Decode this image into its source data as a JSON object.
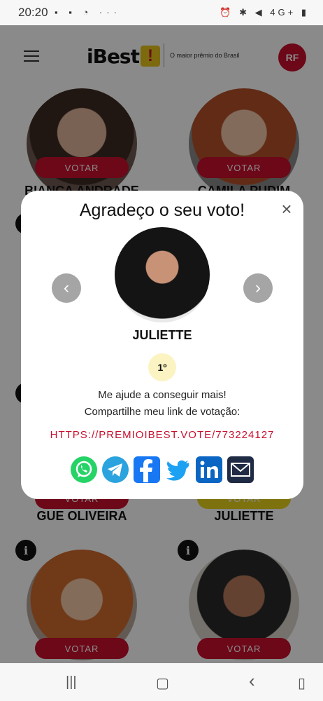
{
  "status_bar": {
    "time": "20:20",
    "left_icons": "▪ ▪ ◔ ···",
    "right_icons": "⏰ ✱ ◀ 4G+ ▮"
  },
  "header": {
    "logo_text": "iBest",
    "logo_mark": "!",
    "tagline": "O maior prêmio do Brasil",
    "user_initials": "RF"
  },
  "cards": [
    {
      "name": "BIANCA ANDRADE",
      "vote": "VOTAR"
    },
    {
      "name": "CAMILA PUDIM",
      "vote": "VOTAR"
    },
    {
      "name": "GUE OLIVEIRA",
      "vote": "VOTAR"
    },
    {
      "name": "JULIETTE",
      "vote": "VOTAR"
    },
    {
      "name": "",
      "vote": "VOTAR"
    },
    {
      "name": "",
      "vote": "VOTAR"
    }
  ],
  "modal": {
    "title": "Agradeço o seu voto!",
    "close": "×",
    "candidate_name": "JULIETTE",
    "rank": "1º",
    "help_line1": "Me ajude a conseguir mais!",
    "help_line2": "Compartilhe meu link de votação:",
    "vote_link": "HTTPS://PREMIOIBEST.VOTE/773224127",
    "share": [
      "whatsapp-icon",
      "telegram-icon",
      "facebook-icon",
      "twitter-icon",
      "linkedin-icon",
      "email-icon"
    ]
  },
  "colors": {
    "brand_red": "#c8102e",
    "brand_yellow": "#e8c21a",
    "rank_bg": "#fbf3c2"
  },
  "navbar": {
    "recents": "|||",
    "home": "▢",
    "back": "‹",
    "assist": "▯"
  }
}
